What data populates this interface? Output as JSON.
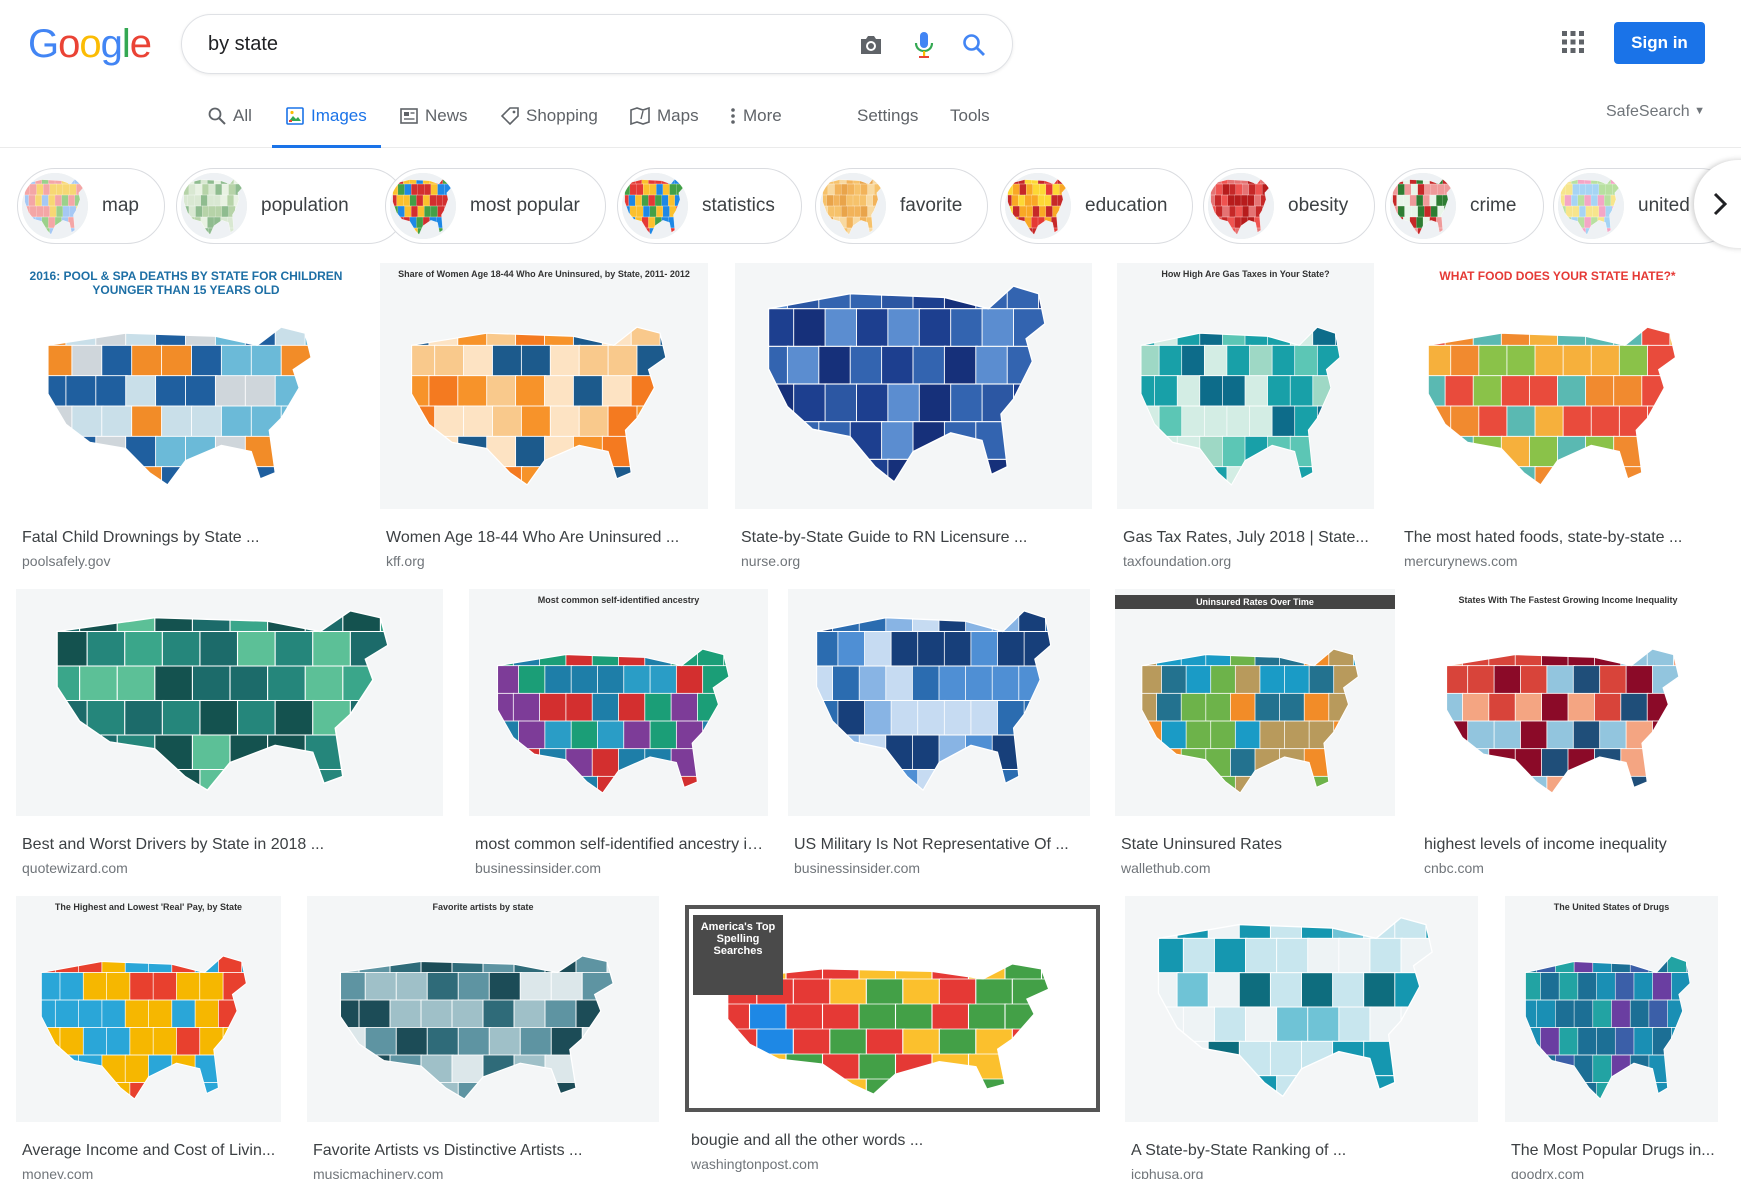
{
  "logo": {
    "letters": [
      "G",
      "o",
      "o",
      "g",
      "l",
      "e"
    ],
    "colors": [
      "#4285f4",
      "#ea4335",
      "#fbbc05",
      "#4285f4",
      "#34a853",
      "#ea4335"
    ]
  },
  "search": {
    "query": "by state"
  },
  "header": {
    "signin_label": "Sign in"
  },
  "tabs": [
    {
      "label": "All",
      "icon": "search-icon",
      "active": false
    },
    {
      "label": "Images",
      "icon": "image-icon",
      "active": true
    },
    {
      "label": "News",
      "icon": "news-icon",
      "active": false
    },
    {
      "label": "Shopping",
      "icon": "tag-icon",
      "active": false
    },
    {
      "label": "Maps",
      "icon": "map-icon",
      "active": false
    },
    {
      "label": "More",
      "icon": "dots-vertical-icon",
      "active": false
    }
  ],
  "tools": {
    "settings": "Settings",
    "tools": "Tools",
    "safesearch": "SafeSearch"
  },
  "chips": [
    {
      "label": "map"
    },
    {
      "label": "population"
    },
    {
      "label": "most popular"
    },
    {
      "label": "statistics"
    },
    {
      "label": "favorite"
    },
    {
      "label": "education"
    },
    {
      "label": "obesity"
    },
    {
      "label": "crime"
    },
    {
      "label": "united"
    }
  ],
  "results": [
    {
      "title": "Fatal Child Drownings by State ...",
      "source": "poolsafely.gov",
      "heading": "2016: POOL & SPA DEATHS BY STATE FOR CHILDREN YOUNGER THAN 15 YEARS OLD",
      "palette": [
        "#1f5f9f",
        "#6bbad8",
        "#c9dfe9",
        "#f28c28",
        "#cfd6db"
      ]
    },
    {
      "title": "Women Age 18-44 Who Are Uninsured ...",
      "source": "kff.org",
      "heading": "Share of Women Age 18-44 Who Are Uninsured, by State, 2011- 2012",
      "palette": [
        "#f7932a",
        "#f9c98c",
        "#1c5a8c",
        "#fde3c3",
        "#f47a20"
      ]
    },
    {
      "title": "State-by-State Guide to RN Licensure ...",
      "source": "nurse.org",
      "heading": "",
      "palette": [
        "#1d3f8f",
        "#3364b0",
        "#5b8dd0",
        "#2c57a3",
        "#16307a"
      ]
    },
    {
      "title": "Gas Tax Rates, July 2018 | State...",
      "source": "taxfoundation.org",
      "heading": "How High Are Gas Taxes in Your State?",
      "palette": [
        "#0d6c8a",
        "#18a0a8",
        "#5cc6b5",
        "#9ed8c5",
        "#d3ede4"
      ]
    },
    {
      "title": "The most hated foods, state-by-state ...",
      "source": "mercurynews.com",
      "heading": "WHAT FOOD DOES YOUR STATE HATE?*",
      "palette": [
        "#e94b3c",
        "#f6b03c",
        "#5ab9b2",
        "#8ac249",
        "#f18a2f"
      ]
    },
    {
      "title": "Best and Worst Drivers by State in 2018 ...",
      "source": "quotewizard.com",
      "heading": "",
      "palette": [
        "#1c6b6a",
        "#25867b",
        "#3aa68a",
        "#5cc097",
        "#14524f"
      ]
    },
    {
      "title": "most common self-identified ancestry in every US st...",
      "source": "businessinsider.com",
      "heading": "Most common self-identified ancestry",
      "palette": [
        "#1e7ea8",
        "#2a9dc6",
        "#7d3c98",
        "#d32f2f",
        "#1b9e77"
      ]
    },
    {
      "title": "US Military Is Not Representative Of ...",
      "source": "businessinsider.com",
      "heading": "",
      "palette": [
        "#2b6cb0",
        "#4f8fd4",
        "#88b4e4",
        "#c6dbf2",
        "#173f7a"
      ]
    },
    {
      "title": "State Uninsured Rates",
      "source": "wallethub.com",
      "heading": "Uninsured Rates Over Time",
      "palette": [
        "#f28c28",
        "#1a9bc6",
        "#6db34a",
        "#b89a5c",
        "#23728f"
      ]
    },
    {
      "title": "highest levels of income inequality",
      "source": "cnbc.com",
      "heading": "States With The Fastest Growing Income Inequality",
      "palette": [
        "#8b0a28",
        "#d8443a",
        "#f4a582",
        "#92c5de",
        "#1f4e79"
      ]
    },
    {
      "title": "Average Income and Cost of Livin...",
      "source": "money.com",
      "heading": "The Highest and Lowest 'Real' Pay, by State",
      "palette": [
        "#f6b700",
        "#2aa6d8",
        "#e8402e",
        "#f6b700",
        "#2aa6d8"
      ]
    },
    {
      "title": "Favorite Artists vs Distinctive Artists ...",
      "source": "musicmachinery.com",
      "heading": "Favorite artists by state",
      "palette": [
        "#dce7ea",
        "#9fc0c8",
        "#5e94a2",
        "#2f6b79",
        "#1c4c57"
      ]
    },
    {
      "title": "bougie and all the other words ...",
      "source": "washingtonpost.com",
      "heading": "America's Top Spelling Searches",
      "palette": [
        "#e53935",
        "#43a047",
        "#fbc02d",
        "#1e88e5",
        "#e53935"
      ]
    },
    {
      "title": "A State-by-State Ranking of ...",
      "source": "icphusa.org",
      "heading": "",
      "palette": [
        "#eef3f5",
        "#c8e6ee",
        "#6fc3d6",
        "#1597b0",
        "#0e6d7e"
      ]
    },
    {
      "title": "The Most Popular Drugs in...",
      "source": "goodrx.com",
      "heading": "The United States of Drugs",
      "palette": [
        "#1a8fb4",
        "#22a3a3",
        "#6a3ea1",
        "#3b5fa8",
        "#1c6f95"
      ]
    }
  ]
}
